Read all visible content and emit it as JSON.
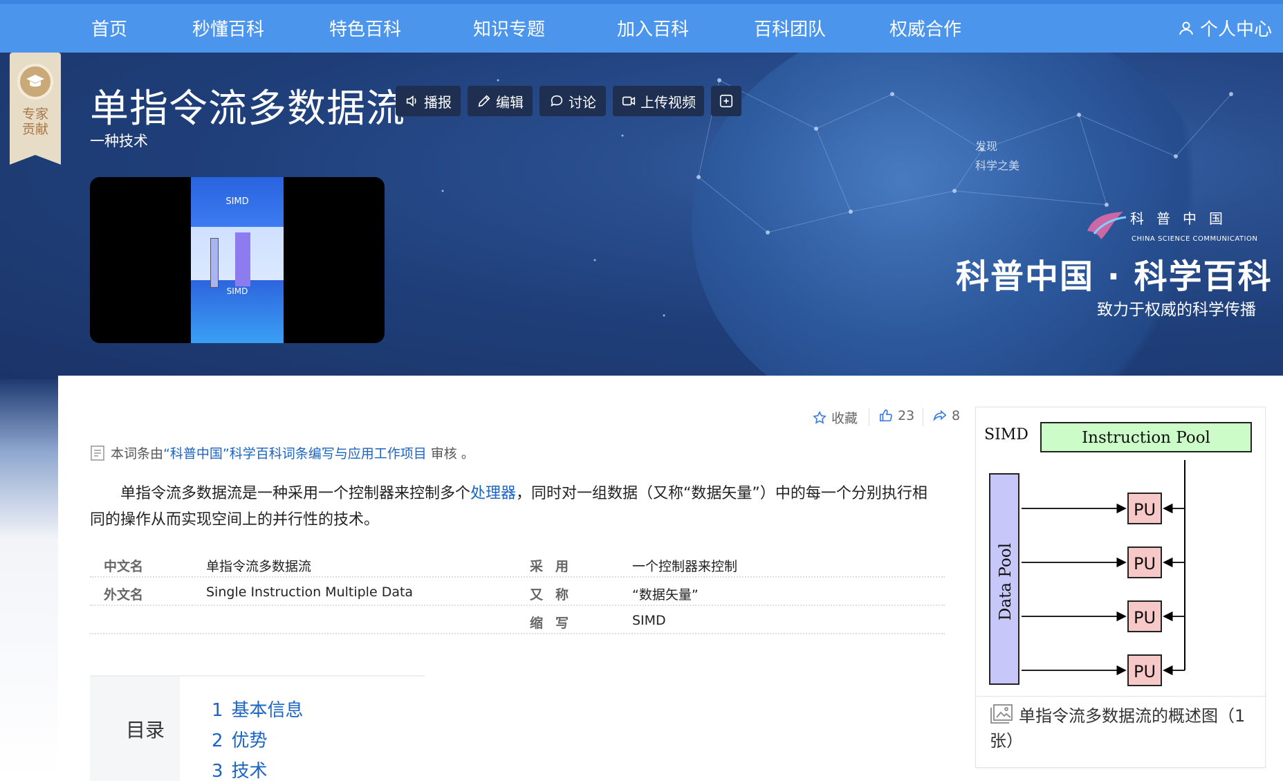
{
  "nav": {
    "items": [
      "首页",
      "秒懂百科",
      "特色百科",
      "知识专题",
      "加入百科",
      "百科团队",
      "权威合作"
    ],
    "user_center": "个人中心"
  },
  "badge": {
    "text_line1": "专家",
    "text_line2": "贡献"
  },
  "entry": {
    "title": "单指令流多数据流",
    "subtitle": "一种技术",
    "actions": {
      "play": "播报",
      "edit": "编辑",
      "discuss": "讨论",
      "upload_video": "上传视频"
    }
  },
  "video": {
    "thumb_title": "SIMD",
    "thumb_title2": "SIMD"
  },
  "brand": {
    "discover_line1": "发现",
    "discover_line2": "科学之美",
    "logo_cn": "科普中国",
    "logo_en": "CHINA SCIENCE COMMUNICATION",
    "main": "科普中国 · 科学百科",
    "sub": "致力于权威的科学传播"
  },
  "stats": {
    "favorite": "收藏",
    "likes": "23",
    "shares": "8"
  },
  "review": {
    "prefix": "本词条由",
    "project": "“科普中国”科学百科词条编写与应用工作项目",
    "suffix": "审核 。"
  },
  "summary": {
    "part1": "单指令流多数据流是一种采用一个控制器来控制多个",
    "link": "处理器",
    "part2": "，同时对一组数据（又称“数据矢量”）中的每一个分别执行相同的操作从而实现空间上的并行性的技术。"
  },
  "info": [
    {
      "k1": "中文名",
      "v1": "单指令流多数据流",
      "k2": "采用",
      "v2": "一个控制器来控制"
    },
    {
      "k1": "外文名",
      "v1": "Single Instruction Multiple Data",
      "k2": "又称",
      "v2": "“数据矢量”"
    },
    {
      "k1": "",
      "v1": "",
      "k2": "缩写",
      "v2": "SIMD"
    }
  ],
  "toc": {
    "label": "目录",
    "items": [
      {
        "num": "1",
        "label": "基本信息"
      },
      {
        "num": "2",
        "label": "优势"
      },
      {
        "num": "3",
        "label": "技术"
      }
    ]
  },
  "figure": {
    "simd_label": "SIMD",
    "instruction_pool": "Instruction Pool",
    "data_pool": "Data Pool",
    "pu": "PU",
    "caption": "单指令流多数据流的概述图（1张）"
  },
  "colors": {
    "nav_bg": "#4b95ec",
    "link": "#1a64c4",
    "pool_green": "#ccfcc8",
    "pool_blue": "#c7c7fa",
    "pu_pink": "#f7c8c8"
  }
}
